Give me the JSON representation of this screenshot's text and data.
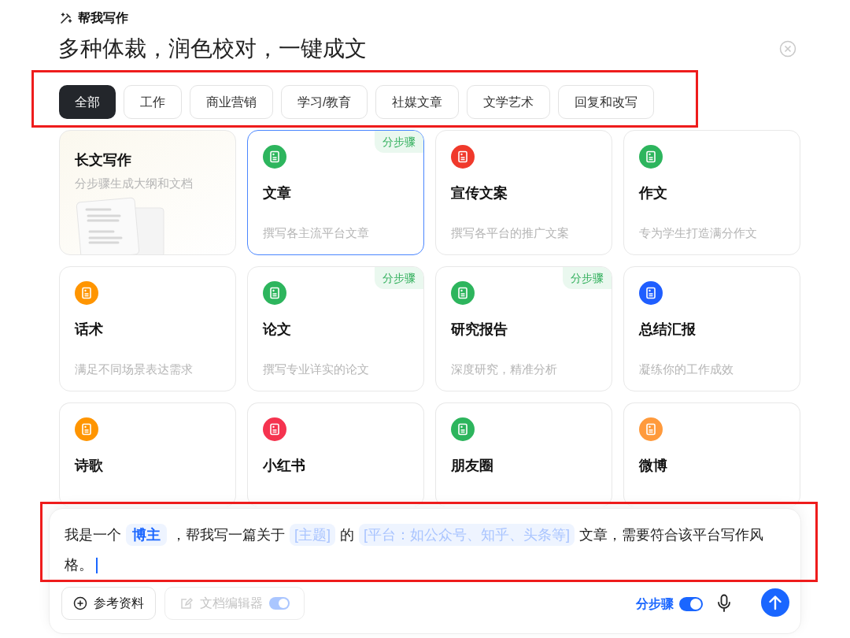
{
  "header": {
    "label": "帮我写作",
    "title": "多种体裁，润色校对，一键成文"
  },
  "tabs": [
    {
      "label": "全部",
      "selected": true
    },
    {
      "label": "工作",
      "selected": false
    },
    {
      "label": "商业营销",
      "selected": false
    },
    {
      "label": "学习/教育",
      "selected": false
    },
    {
      "label": "社媒文章",
      "selected": false
    },
    {
      "label": "文学艺术",
      "selected": false
    },
    {
      "label": "回复和改写",
      "selected": false
    }
  ],
  "cards": [
    {
      "kind": "feature",
      "title": "长文写作",
      "description": "分步骤生成大纲和文档",
      "selected": false
    },
    {
      "kind": "template",
      "title": "文章",
      "description": "撰写各主流平台文章",
      "color": "#2db55d",
      "badge": "分步骤",
      "selected": true
    },
    {
      "kind": "template",
      "title": "宣传文案",
      "description": "撰写各平台的推广文案",
      "color": "#f0392b",
      "selected": false
    },
    {
      "kind": "template",
      "title": "作文",
      "description": "专为学生打造满分作文",
      "color": "#2db55d",
      "selected": false
    },
    {
      "kind": "template",
      "title": "话术",
      "description": "满足不同场景表达需求",
      "color": "#ff9500",
      "selected": false
    },
    {
      "kind": "template",
      "title": "论文",
      "description": "撰写专业详实的论文",
      "color": "#2db55d",
      "badge": "分步骤",
      "selected": false
    },
    {
      "kind": "template",
      "title": "研究报告",
      "description": "深度研究，精准分析",
      "color": "#2db55d",
      "badge": "分步骤",
      "selected": false
    },
    {
      "kind": "template",
      "title": "总结汇报",
      "description": "凝练你的工作成效",
      "color": "#1f5eff",
      "selected": false
    },
    {
      "kind": "template",
      "title": "诗歌",
      "color": "#ff9500",
      "selected": false
    },
    {
      "kind": "template",
      "title": "小红书",
      "color": "#f5334f",
      "selected": false
    },
    {
      "kind": "template",
      "title": "朋友圈",
      "color": "#2db55d",
      "selected": false
    },
    {
      "kind": "template",
      "title": "微博",
      "color": "#ff9a3c",
      "selected": false
    }
  ],
  "prompt": {
    "segments": [
      {
        "kind": "text",
        "text": "我是一个"
      },
      {
        "kind": "value",
        "text": "博主"
      },
      {
        "kind": "text",
        "text": "，帮我写一篇关于"
      },
      {
        "kind": "slot",
        "text": "[主题]"
      },
      {
        "kind": "text",
        "text": "的"
      },
      {
        "kind": "slot",
        "text": "[平台：如公众号、知乎、头条等]"
      },
      {
        "kind": "text",
        "text": "文章，需要符合该平台写作风格。"
      }
    ]
  },
  "toolbar": {
    "reference_button": "参考资料",
    "editor_button": {
      "label": "文档编辑器",
      "disabled": true,
      "on": true
    },
    "steps_toggle": {
      "label": "分步骤",
      "on": true
    }
  }
}
